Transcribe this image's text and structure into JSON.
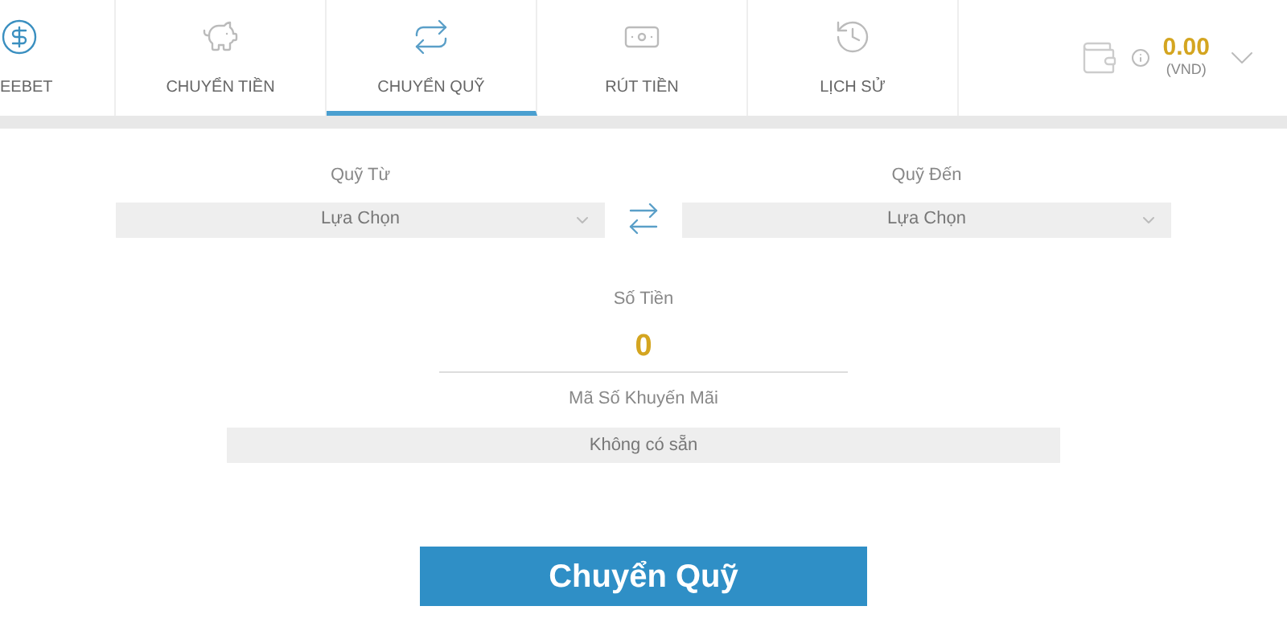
{
  "tabs": [
    {
      "label": "EEBET",
      "kind": "dollar",
      "selected": false
    },
    {
      "label": "CHUYỂN TIỀN",
      "kind": "piggy",
      "selected": false
    },
    {
      "label": "CHUYỂN QUỸ",
      "kind": "transfer",
      "selected": true
    },
    {
      "label": "RÚT TIỀN",
      "kind": "cash",
      "selected": false
    },
    {
      "label": "LỊCH SỬ",
      "kind": "history",
      "selected": false
    }
  ],
  "balance": {
    "amount": "0.00",
    "currency": "(VND)"
  },
  "form": {
    "from": {
      "label": "Quỹ Từ",
      "value": "Lựa Chọn"
    },
    "to": {
      "label": "Quỹ Đến",
      "value": "Lựa Chọn"
    },
    "amount": {
      "label": "Số Tiền",
      "value": "0"
    },
    "promo": {
      "label": "Mã Số Khuyến Mãi",
      "value": "Không có sẵn"
    },
    "submit": "Chuyển Quỹ"
  }
}
